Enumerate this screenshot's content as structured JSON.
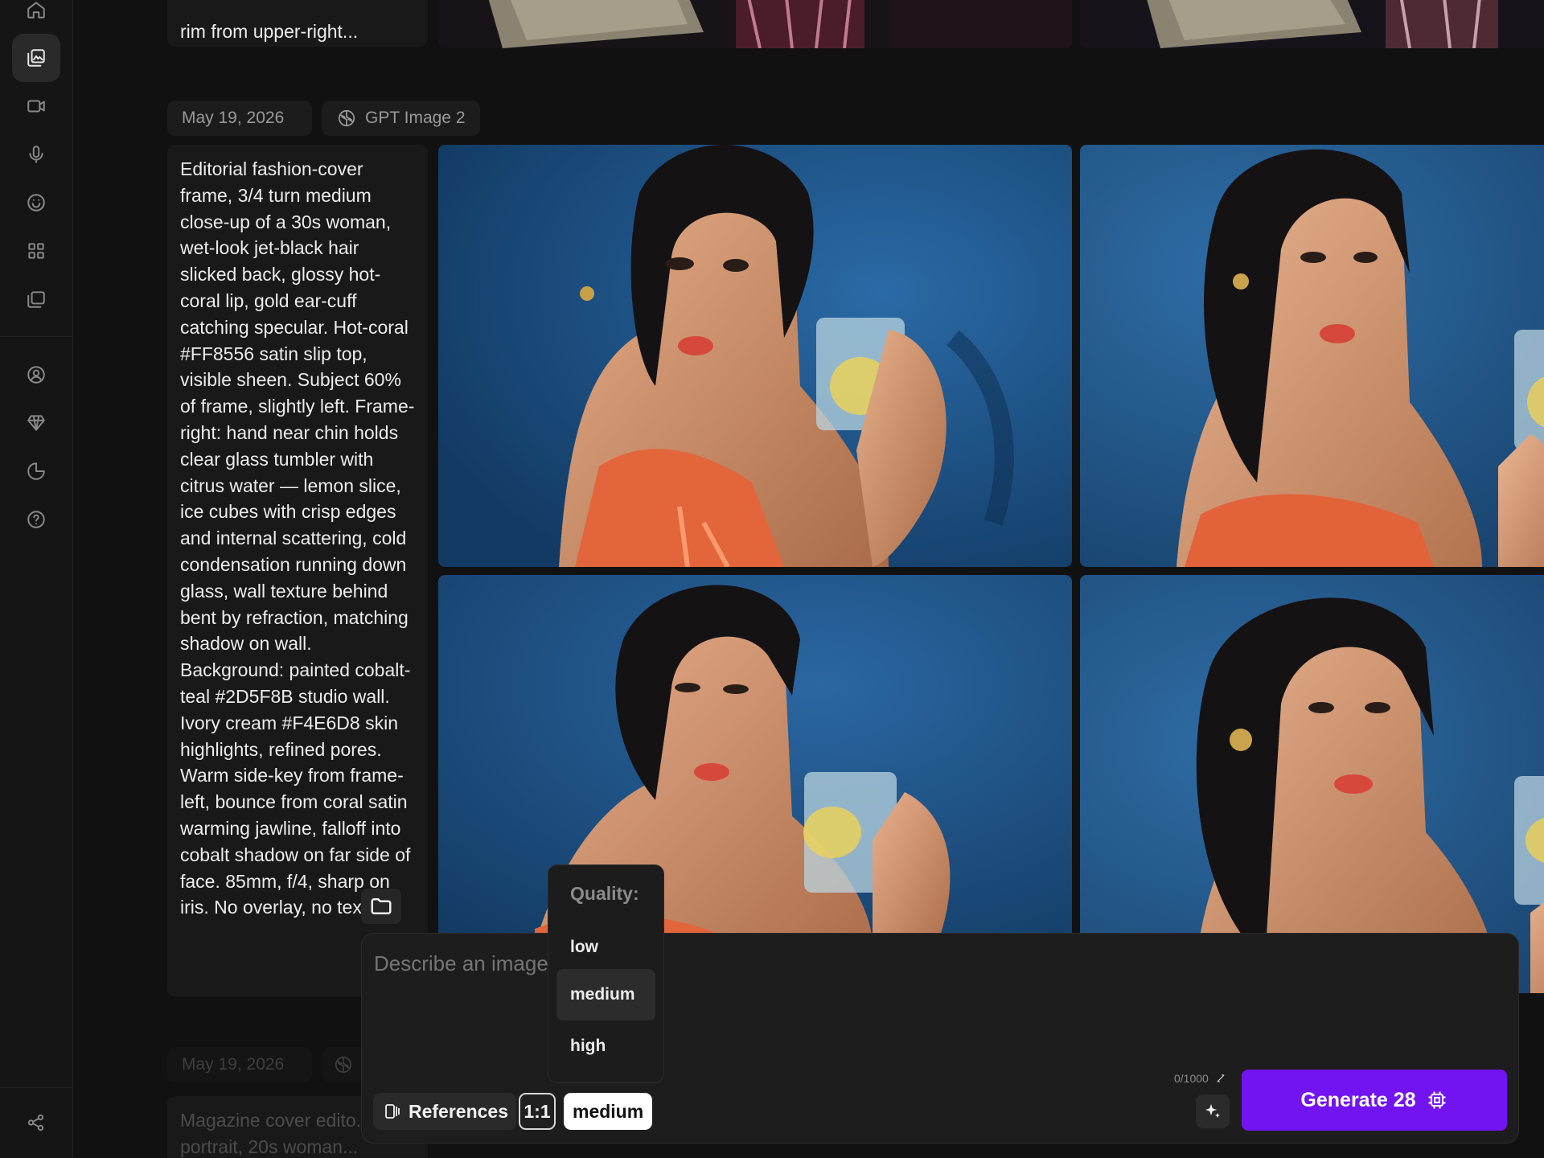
{
  "sidebar": {
    "icons": [
      "home-icon",
      "images-icon",
      "video-icon",
      "microphone-icon",
      "smiley-icon",
      "apps-grid-icon",
      "collections-icon",
      "user-icon",
      "diamond-icon",
      "usage-pie-icon",
      "help-icon",
      "share-icon"
    ],
    "active": "images-icon"
  },
  "feed": {
    "previous_prompt_tail": "rim from upper-right...",
    "group": {
      "date": "May 19, 2026",
      "model": "GPT Image 2",
      "prompt": "Editorial fashion-cover frame, 3/4 turn medium close-up of a 30s woman, wet-look jet-black hair slicked back, glossy hot-coral lip, gold ear-cuff catching specular. Hot-coral #FF8556 satin slip top, visible sheen. Subject 60% of frame, slightly left. Frame-right: hand near chin holds clear glass tumbler with citrus water — lemon slice, ice cubes with crisp edges and internal scattering, cold condensation running down glass, wall texture behind bent by refraction, matching shadow on wall. Background: painted cobalt-teal #2D5F8B studio wall. Ivory cream #F4E6D8 skin highlights, refined pores. Warm side-key from frame-left, bounce from coral satin warming jawline, falloff into cobalt shadow on far side of face. 85mm, f/4, sharp on iris. No overlay, no text."
    },
    "next_group": {
      "date": "May 19, 2026",
      "prompt_start": "Magazine cover edito... portrait, 20s woman..."
    }
  },
  "composer": {
    "placeholder": "Describe an image",
    "references_label": "References",
    "ratio_label": "1:1",
    "quality_label": "medium",
    "counter": "0/1000",
    "generate_label": "Generate 28"
  },
  "quality_menu": {
    "title": "Quality:",
    "options": [
      "low",
      "medium",
      "high"
    ],
    "selected": "medium"
  },
  "colors": {
    "accent": "#7214f2",
    "background": "#111111",
    "card": "#191919",
    "wall_blue": "#2D5F8B",
    "coral": "#FF8556"
  }
}
